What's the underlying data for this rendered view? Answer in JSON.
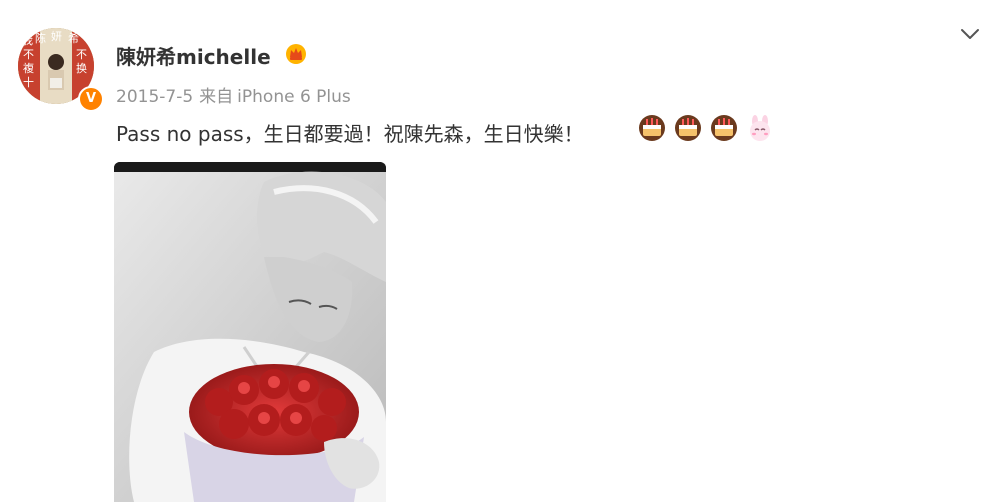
{
  "post": {
    "author_name": "陳妍希michelle",
    "date": "2015-7-5",
    "source_prefix": "来自",
    "source": "iPhone 6 Plus",
    "text": "Pass no pass，生日都要過！祝陳先森，生日快樂！",
    "emojis": [
      "cake-emoji",
      "cake-emoji",
      "cake-emoji",
      "bunny-emoji"
    ]
  },
  "avatar": {
    "lettering": "我陈妍希 不 不 複 换 十"
  },
  "badges": {
    "verified": "V",
    "vip": "crown-icon"
  },
  "menu": {
    "icon": "chevron-down-icon"
  },
  "colors": {
    "verified_badge": "#ff8200",
    "meta_text": "#939393",
    "body_text": "#333333"
  }
}
